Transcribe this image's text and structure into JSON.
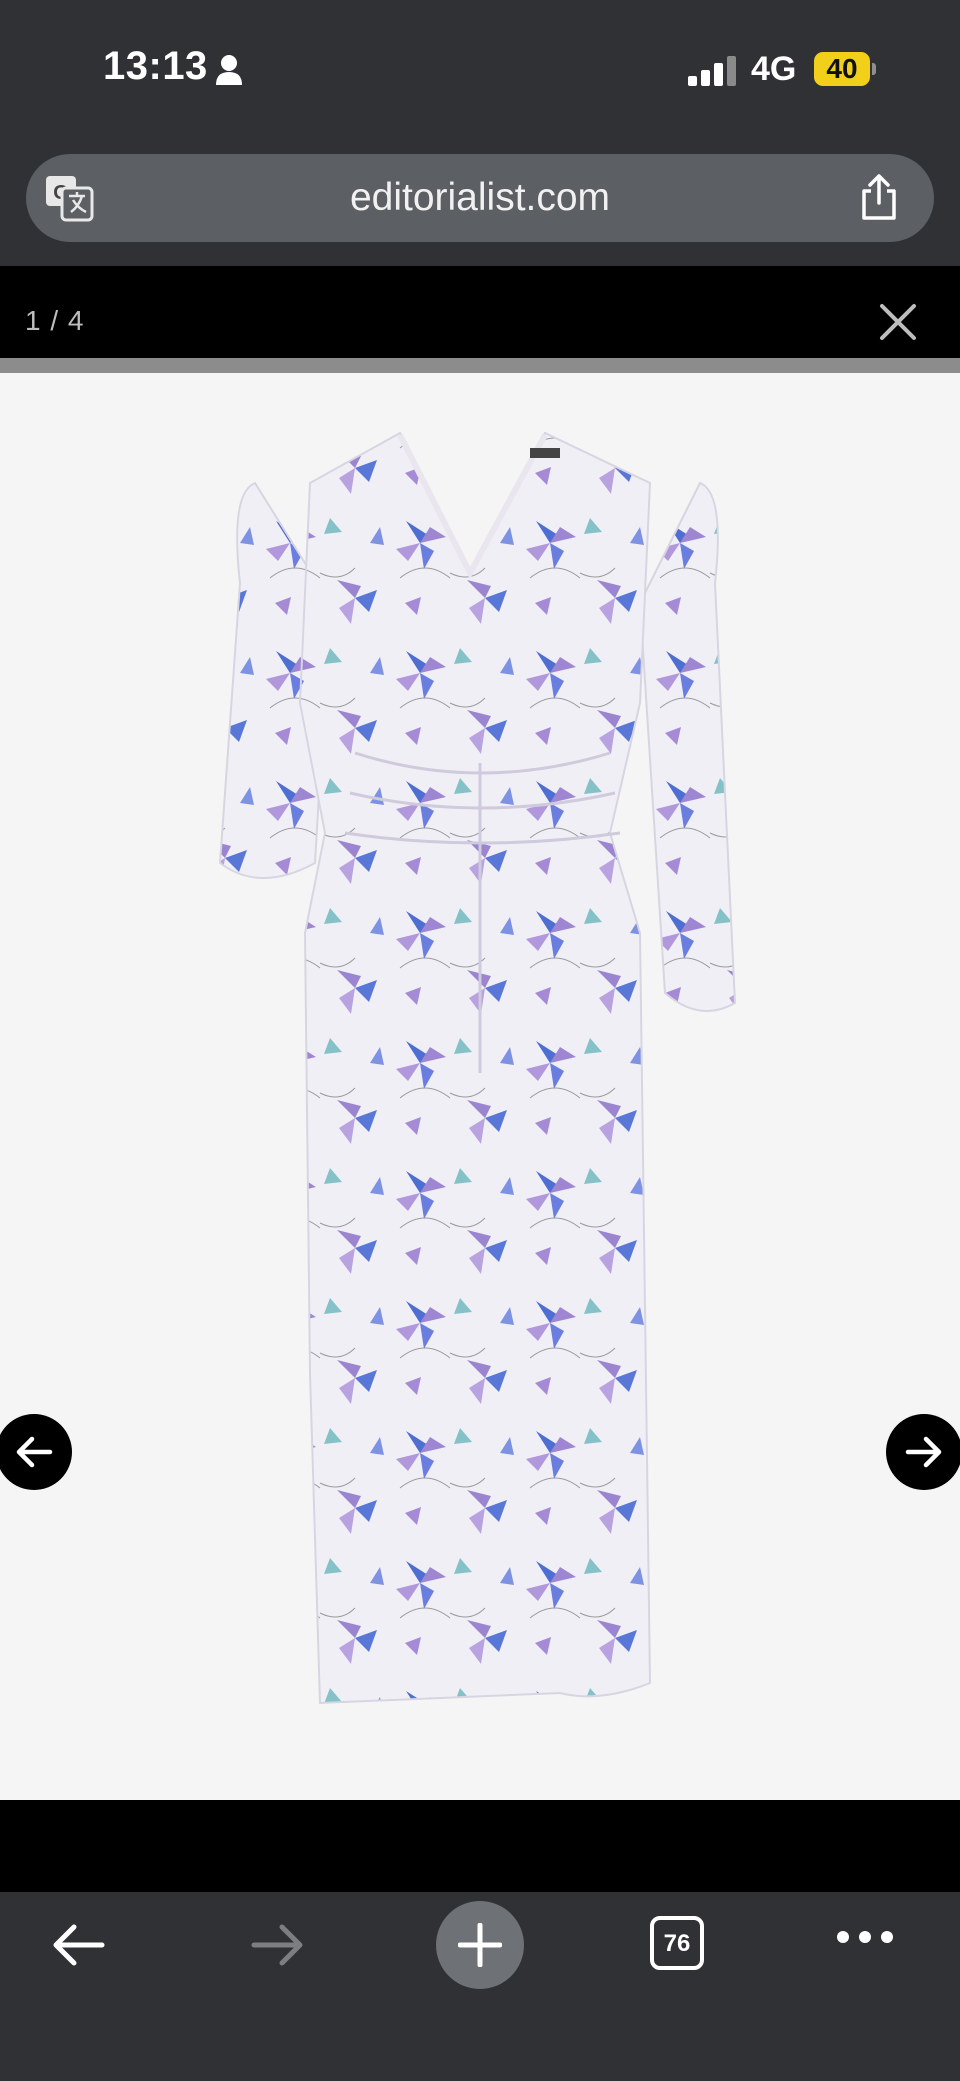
{
  "status_bar": {
    "time": "13:13",
    "network": "4G",
    "battery": "40"
  },
  "browser": {
    "url": "editorialist.com"
  },
  "lightbox": {
    "counter": "1 / 4"
  },
  "toolbar": {
    "tab_count": "76"
  },
  "colors": {
    "dark_bg": "#2f3134",
    "lightbox_bg": "#000000",
    "battery": "#f1cf1a",
    "stage_bg": "#f5f5f5"
  }
}
